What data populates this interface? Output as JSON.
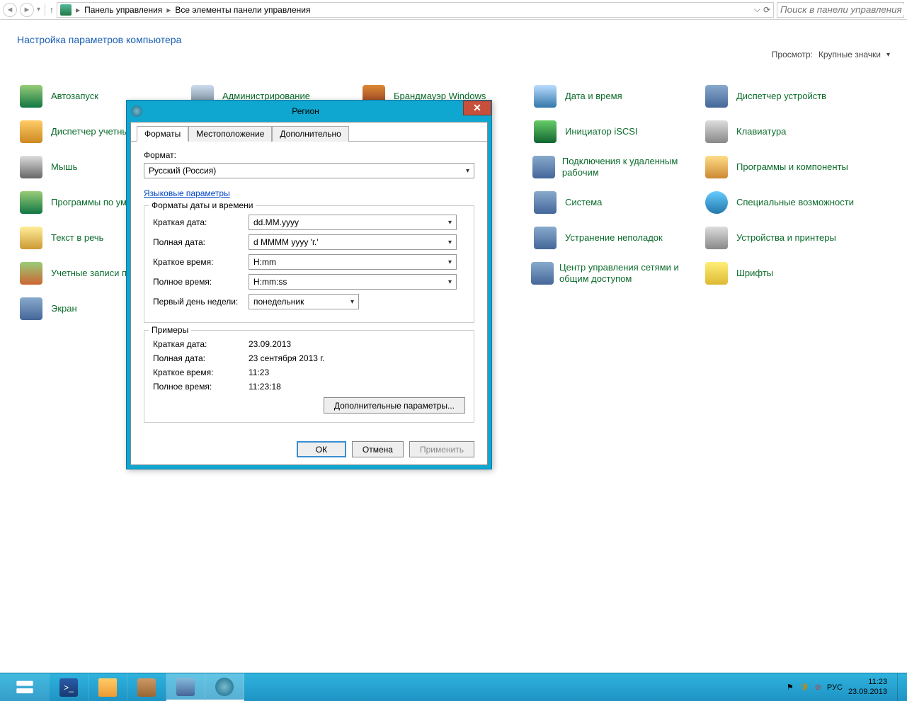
{
  "nav": {
    "crumb1": "Панель управления",
    "crumb2": "Все элементы панели управления",
    "search_placeholder": "Поиск в панели управления"
  },
  "header": {
    "title": "Настройка параметров компьютера",
    "view_label": "Просмотр:",
    "view_value": "Крупные значки"
  },
  "items": {
    "autorun": "Автозапуск",
    "admin": "Администрирование",
    "firewall": "Брандмауэр Windows",
    "datetime": "Дата и время",
    "devmgr": "Диспетчер устройств",
    "creds": "Диспетчер учетных данных",
    "iscsi": "Инициатор iSCSI",
    "keyboard": "Клавиатура",
    "mouse": "Мышь",
    "rdp": "Подключения к удаленным рабочим",
    "programs": "Программы и компоненты",
    "defaults": "Программы по умолчанию",
    "system": "Система",
    "access": "Специальные возможности",
    "tts": "Текст в речь",
    "trouble": "Устранение неполадок",
    "printers": "Устройства и принтеры",
    "users": "Учетные записи пользователей",
    "network": "Центр управления сетями и общим доступом",
    "fonts": "Шрифты",
    "display": "Экран"
  },
  "dialog": {
    "title": "Регион",
    "tabs": {
      "formats": "Форматы",
      "location": "Местоположение",
      "additional": "Дополнительно"
    },
    "format_label": "Формат:",
    "format_value": "Русский (Россия)",
    "lang_link": "Языковые параметры",
    "dt_fieldset": "Форматы даты и времени",
    "short_date_label": "Краткая дата:",
    "short_date_value": "dd.MM.yyyy",
    "long_date_label": "Полная дата:",
    "long_date_value": "d MMMM yyyy 'г.'",
    "short_time_label": "Краткое время:",
    "short_time_value": "H:mm",
    "long_time_label": "Полное время:",
    "long_time_value": "H:mm:ss",
    "first_day_label": "Первый день недели:",
    "first_day_value": "понедельник",
    "examples_fieldset": "Примеры",
    "ex_short_date_label": "Краткая дата:",
    "ex_short_date_value": "23.09.2013",
    "ex_long_date_label": "Полная дата:",
    "ex_long_date_value": "23 сентября 2013 г.",
    "ex_short_time_label": "Краткое время:",
    "ex_short_time_value": "11:23",
    "ex_long_time_label": "Полное время:",
    "ex_long_time_value": "11:23:18",
    "additional_btn": "Дополнительные параметры...",
    "ok": "ОК",
    "cancel": "Отмена",
    "apply": "Применить"
  },
  "taskbar": {
    "lang": "РУС",
    "time": "11:23",
    "date": "23.09.2013"
  }
}
